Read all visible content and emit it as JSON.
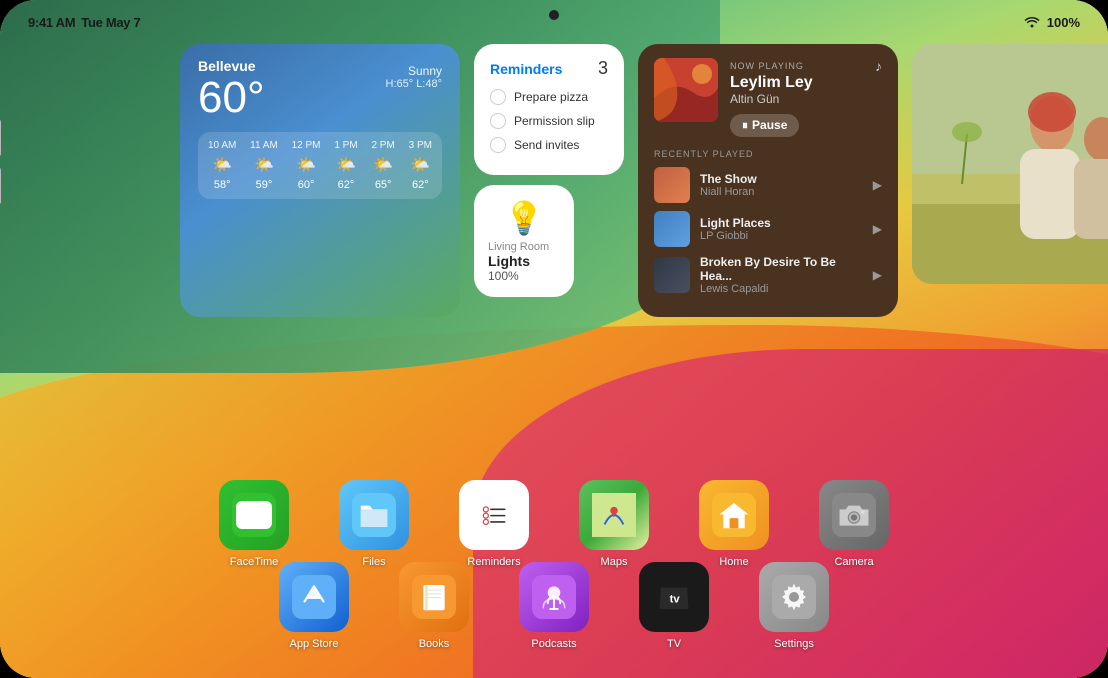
{
  "statusBar": {
    "time": "9:41 AM",
    "date": "Tue May 7",
    "wifi": "WiFi",
    "battery": "100%"
  },
  "widgets": {
    "weather": {
      "location": "Bellevue",
      "temp": "60°",
      "condition": "Sunny",
      "hiLo": "H:65° L:48°",
      "forecast": [
        {
          "time": "10 AM",
          "icon": "🌤️",
          "temp": "58°"
        },
        {
          "time": "11 AM",
          "icon": "🌤️",
          "temp": "59°"
        },
        {
          "time": "12 PM",
          "icon": "🌤️",
          "temp": "60°"
        },
        {
          "time": "1 PM",
          "icon": "🌤️",
          "temp": "62°"
        },
        {
          "time": "2 PM",
          "icon": "🌤️",
          "temp": "65°"
        },
        {
          "time": "3 PM",
          "icon": "🌤️",
          "temp": "62°"
        }
      ]
    },
    "reminders": {
      "title": "Reminders",
      "count": "3",
      "items": [
        "Prepare pizza",
        "Permission slip",
        "Send invites"
      ]
    },
    "lights": {
      "room": "Living Room",
      "name": "Lights",
      "percent": "100%"
    },
    "nowPlaying": {
      "label": "NOW PLAYING",
      "song": "Leylim Ley",
      "artist": "Altin Gün",
      "pauseLabel": "Pause",
      "recentlyPlayedLabel": "RECENTLY PLAYED",
      "tracks": [
        {
          "song": "The Show",
          "artist": "Niall Horan"
        },
        {
          "song": "Light Places",
          "artist": "LP Giobbi"
        },
        {
          "song": "Broken By Desire To Be Hea...",
          "artist": "Lewis Capaldi"
        }
      ]
    }
  },
  "apps": {
    "row1": [
      {
        "name": "FaceTime",
        "icon": "facetime"
      },
      {
        "name": "Files",
        "icon": "files"
      },
      {
        "name": "Reminders",
        "icon": "reminders"
      },
      {
        "name": "Maps",
        "icon": "maps"
      },
      {
        "name": "Home",
        "icon": "home"
      },
      {
        "name": "Camera",
        "icon": "camera"
      }
    ],
    "row2": [
      {
        "name": "App Store",
        "icon": "appstore"
      },
      {
        "name": "Books",
        "icon": "books"
      },
      {
        "name": "Podcasts",
        "icon": "podcasts"
      },
      {
        "name": "TV",
        "icon": "tv"
      },
      {
        "name": "Settings",
        "icon": "settings"
      }
    ]
  }
}
